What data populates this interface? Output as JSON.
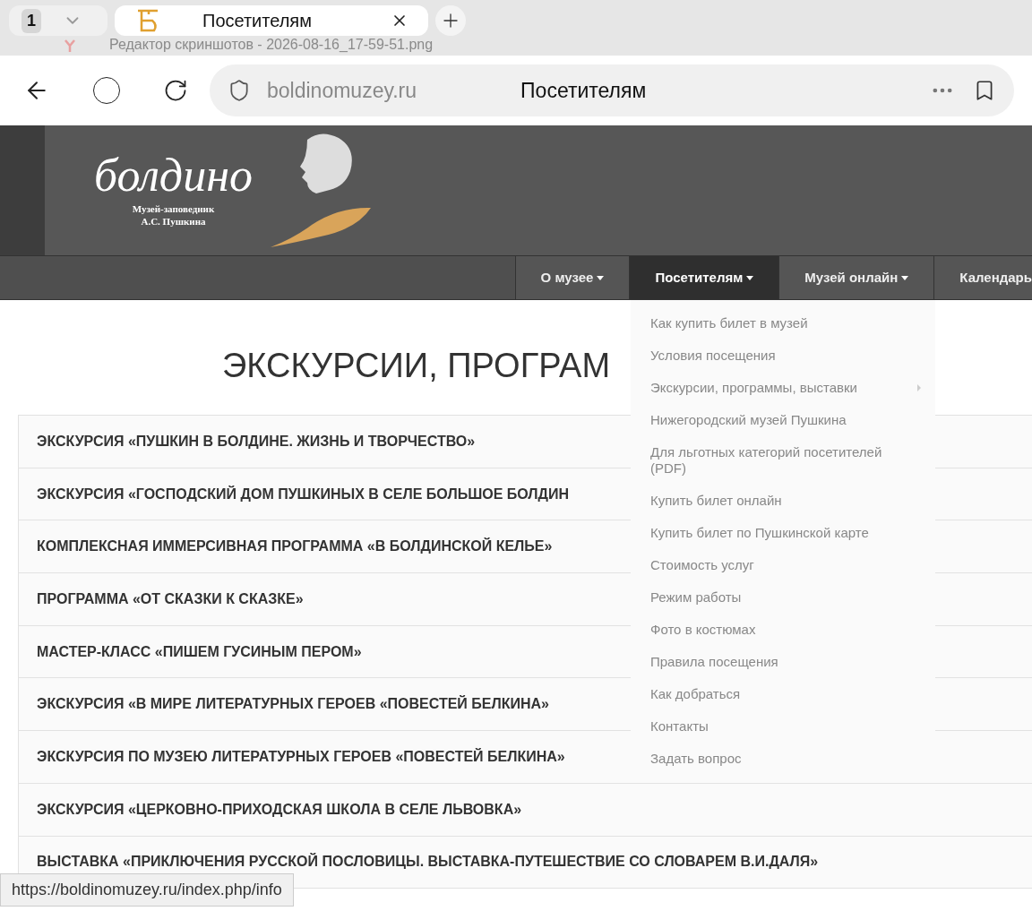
{
  "browser": {
    "tab_count": "1",
    "tabs": [
      {
        "title": "Посетителям",
        "selected": true
      }
    ],
    "ghost_title": "Редактор скриншотов - 2026-08-16_17-59-51.png",
    "address": "boldinomuzey.ru",
    "page_title": "Посетителям"
  },
  "site": {
    "logo_text": "болдино",
    "logo_caption": [
      "Музей-заповедник",
      "А.С. Пушкина"
    ],
    "nav": [
      {
        "label": "О музее",
        "selected": false
      },
      {
        "label": "Посетителям",
        "selected": true
      },
      {
        "label": "Музей онлайн",
        "selected": false
      },
      {
        "label": "Календарь",
        "selected": false
      }
    ],
    "dropdown": [
      {
        "label": "Как купить билет в музей",
        "submenu": false
      },
      {
        "label": "Условия посещения",
        "submenu": false
      },
      {
        "label": "Экскурсии, программы, выставки",
        "submenu": true
      },
      {
        "label": "Нижегородский музей Пушкина",
        "submenu": false
      },
      {
        "label": "Для льготных категорий посетителей (PDF)",
        "submenu": false
      },
      {
        "label": "Купить билет онлайн",
        "submenu": false
      },
      {
        "label": "Купить билет по Пушкинской карте",
        "submenu": false
      },
      {
        "label": "Стоимость услуг",
        "submenu": false
      },
      {
        "label": "Режим работы",
        "submenu": false
      },
      {
        "label": "Фото в костюмах",
        "submenu": false
      },
      {
        "label": "Правила посещения",
        "submenu": false
      },
      {
        "label": "Как добраться",
        "submenu": false
      },
      {
        "label": "Контакты",
        "submenu": false
      },
      {
        "label": "Задать вопрос",
        "submenu": false
      }
    ],
    "heading": "ЭКСКУРСИИ, ПРОГРАМ",
    "rows": [
      "ЭКСКУРСИЯ «ПУШКИН В БОЛДИНЕ. ЖИЗНЬ И ТВОРЧЕСТВО»",
      "ЭКСКУРСИЯ «ГОСПОДСКИЙ ДОМ ПУШКИНЫХ В СЕЛЕ БОЛЬШОЕ БОЛДИН",
      "КОМПЛЕКСНАЯ ИММЕРСИВНАЯ ПРОГРАММА «В БОЛДИНСКОЙ КЕЛЬЕ»",
      "ПРОГРАММА «ОТ СКАЗКИ К СКАЗКЕ»",
      "МАСТЕР-КЛАСС «ПИШЕМ ГУСИНЫМ ПЕРОМ»",
      "ЭКСКУРСИЯ «В МИРЕ ЛИТЕРАТУРНЫХ ГЕРОЕВ «ПОВЕСТЕЙ БЕЛКИНА»",
      "ЭКСКУРСИЯ ПО МУЗЕЮ ЛИТЕРАТУРНЫХ ГЕРОЕВ «ПОВЕСТЕЙ БЕЛКИНА»",
      "ЭКСКУРСИЯ «ЦЕРКОВНО-ПРИХОДСКАЯ ШКОЛА В СЕЛЕ ЛЬВОВКА»",
      "ВЫСТАВКА «ПРИКЛЮЧЕНИЯ РУССКОЙ ПОСЛОВИЦЫ. ВЫСТАВКА-ПУТЕШЕСТВИЕ СО СЛОВАРЕМ В.И.ДАЛЯ»"
    ]
  },
  "status_bar": {
    "url": "https://boldinomuzey.ru/index.php/info"
  }
}
